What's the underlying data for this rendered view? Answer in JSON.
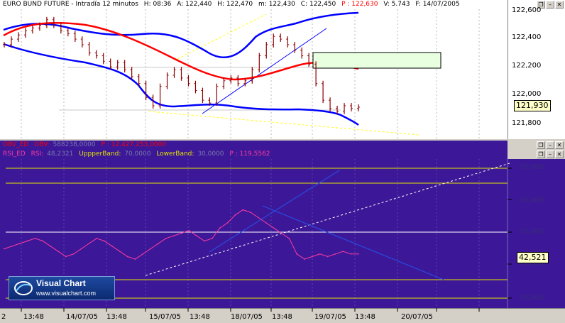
{
  "top_panel": {
    "title": "EURO BUND FUTURE - Intradía 12 minutos",
    "fields": [
      "H: 08:36",
      "A: 122,440",
      "H: 122,470",
      "m: 122,430",
      "C: 122,450",
      "P : 122,630",
      "V: 5.743",
      "F: 14/07/2005"
    ],
    "y_ticks": [
      "122,600",
      "122,400",
      "122,200",
      "122,000",
      "121,800"
    ],
    "last_price": "121,930"
  },
  "bottom_panel": {
    "line1": {
      "name": "OBV_ED",
      "label": "OBV:",
      "value": "588238,0000",
      "p": "P : 12.427.253,0000"
    },
    "line2": {
      "name": "RSI_ED",
      "label": "RSI:",
      "value": "48,2321",
      "upper": "UppperBand:",
      "upper_value": "70,0000",
      "lower": "LowerBand:",
      "lower_value": "30,0000",
      "p": "P : 119,5562"
    },
    "y_ticks": [
      "70,000",
      "60,000",
      "50,000",
      "40,000",
      "30,000"
    ],
    "last_value": "42,521"
  },
  "win_buttons": [
    "restore",
    "minimize",
    "close"
  ],
  "x_axis": {
    "labels": [
      "2",
      "13:48",
      "14/07/05",
      "13:48",
      "15/07/05",
      "13:48",
      "18/07/05",
      "13:48",
      "19/07/05",
      "13:48",
      "20/07/05"
    ]
  },
  "logo": {
    "title": "Visual Chart",
    "url": "www.visualchart.com"
  },
  "colors": {
    "top_bg": "#ffffff",
    "bottom_bg": "#3c1898",
    "bollinger": "#0000ff",
    "moving_avg": "#ff0000",
    "candles": "#8b0000",
    "rsi": "#ff3aa0",
    "band_lines": "#e2e200"
  },
  "chart_data": [
    {
      "type": "line",
      "title": "EURO BUND FUTURE - Intradía 12 minutos",
      "series": [
        {
          "name": "",
          "values": [
            122.38,
            122.42,
            122.45,
            122.48,
            122.5,
            122.52,
            122.56,
            122.52,
            122.48,
            122.46,
            122.42,
            122.38,
            122.32,
            122.3,
            122.26,
            122.22,
            122.25,
            122.2,
            122.15,
            122.1,
            122.0,
            121.94,
            122.08,
            122.16,
            122.2,
            122.14,
            122.1,
            122.05,
            121.98,
            121.96,
            122.08,
            122.12,
            122.14,
            122.1,
            122.12,
            122.2,
            122.3,
            122.38,
            122.44,
            122.42,
            122.38,
            122.34,
            122.3,
            122.24,
            122.1,
            121.98,
            121.92,
            121.9,
            121.94,
            121.92,
            121.93
          ]
        }
      ],
      "ylim": [
        121.72,
        122.62
      ]
    },
    {
      "type": "line",
      "series": [
        {
          "name": "RSI",
          "values": [
            44,
            45,
            46,
            47,
            48,
            47,
            45,
            43,
            41,
            42,
            44,
            46,
            48,
            47,
            45,
            43,
            41,
            40,
            42,
            44,
            46,
            48,
            49,
            50,
            51,
            49,
            47,
            48,
            52,
            54,
            57,
            59,
            58,
            56,
            54,
            52,
            50,
            48,
            42,
            40,
            41,
            42,
            41,
            42,
            43,
            42,
            42
          ]
        }
      ],
      "ylim": [
        25,
        75
      ]
    }
  ]
}
